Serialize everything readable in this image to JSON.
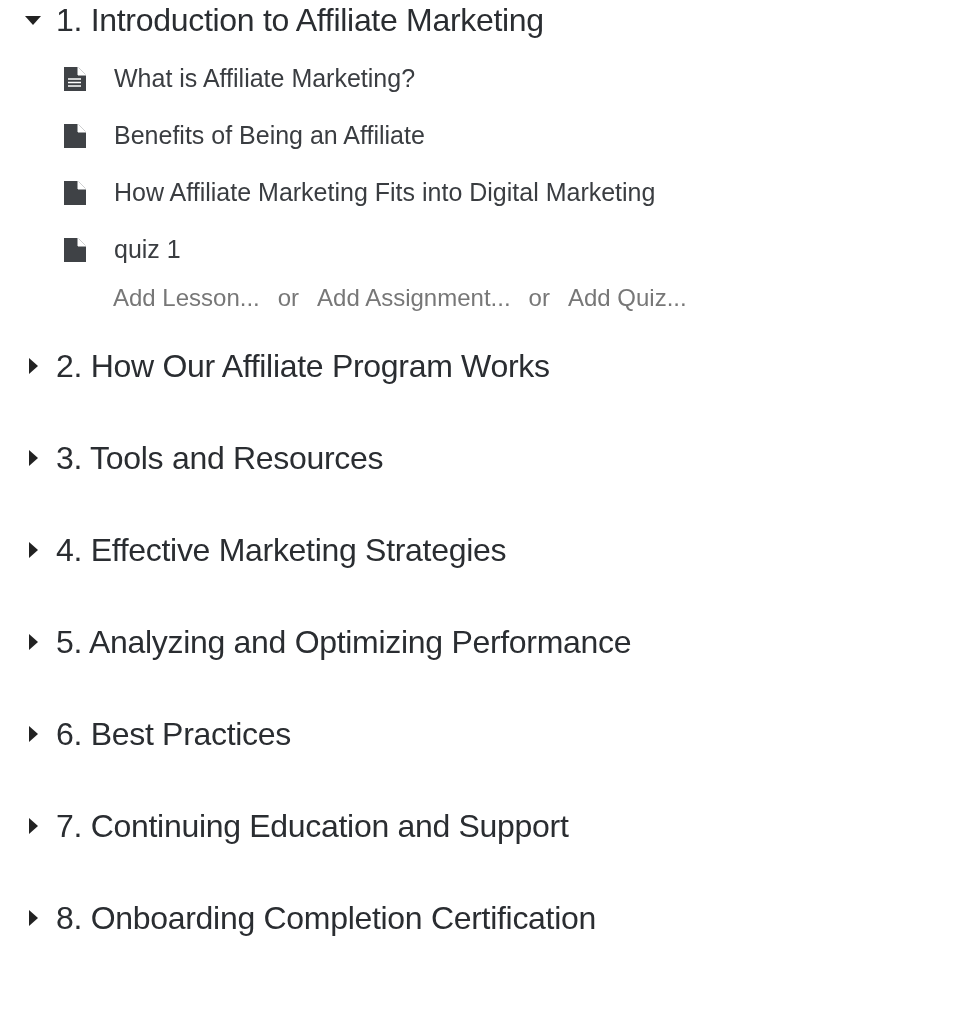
{
  "sections": [
    {
      "title": "1. Introduction to Affiliate Marketing",
      "expanded": true,
      "lessons": [
        {
          "title": "What is Affiliate Marketing?",
          "kind": "text"
        },
        {
          "title": "Benefits of Being an Affiliate",
          "kind": "blank"
        },
        {
          "title": "How Affiliate Marketing Fits into Digital Marketing",
          "kind": "blank"
        },
        {
          "title": "quiz 1",
          "kind": "blank"
        }
      ],
      "add_links": [
        "Add Lesson...",
        "or",
        "Add Assignment...",
        "or",
        "Add Quiz..."
      ]
    },
    {
      "title": "2. How Our Affiliate Program Works",
      "expanded": false
    },
    {
      "title": "3. Tools and Resources",
      "expanded": false
    },
    {
      "title": "4. Effective Marketing Strategies",
      "expanded": false
    },
    {
      "title": "5. Analyzing and Optimizing Performance",
      "expanded": false
    },
    {
      "title": "6. Best Practices",
      "expanded": false
    },
    {
      "title": "7. Continuing Education and Support",
      "expanded": false
    },
    {
      "title": "8. Onboarding Completion Certification",
      "expanded": false
    }
  ]
}
